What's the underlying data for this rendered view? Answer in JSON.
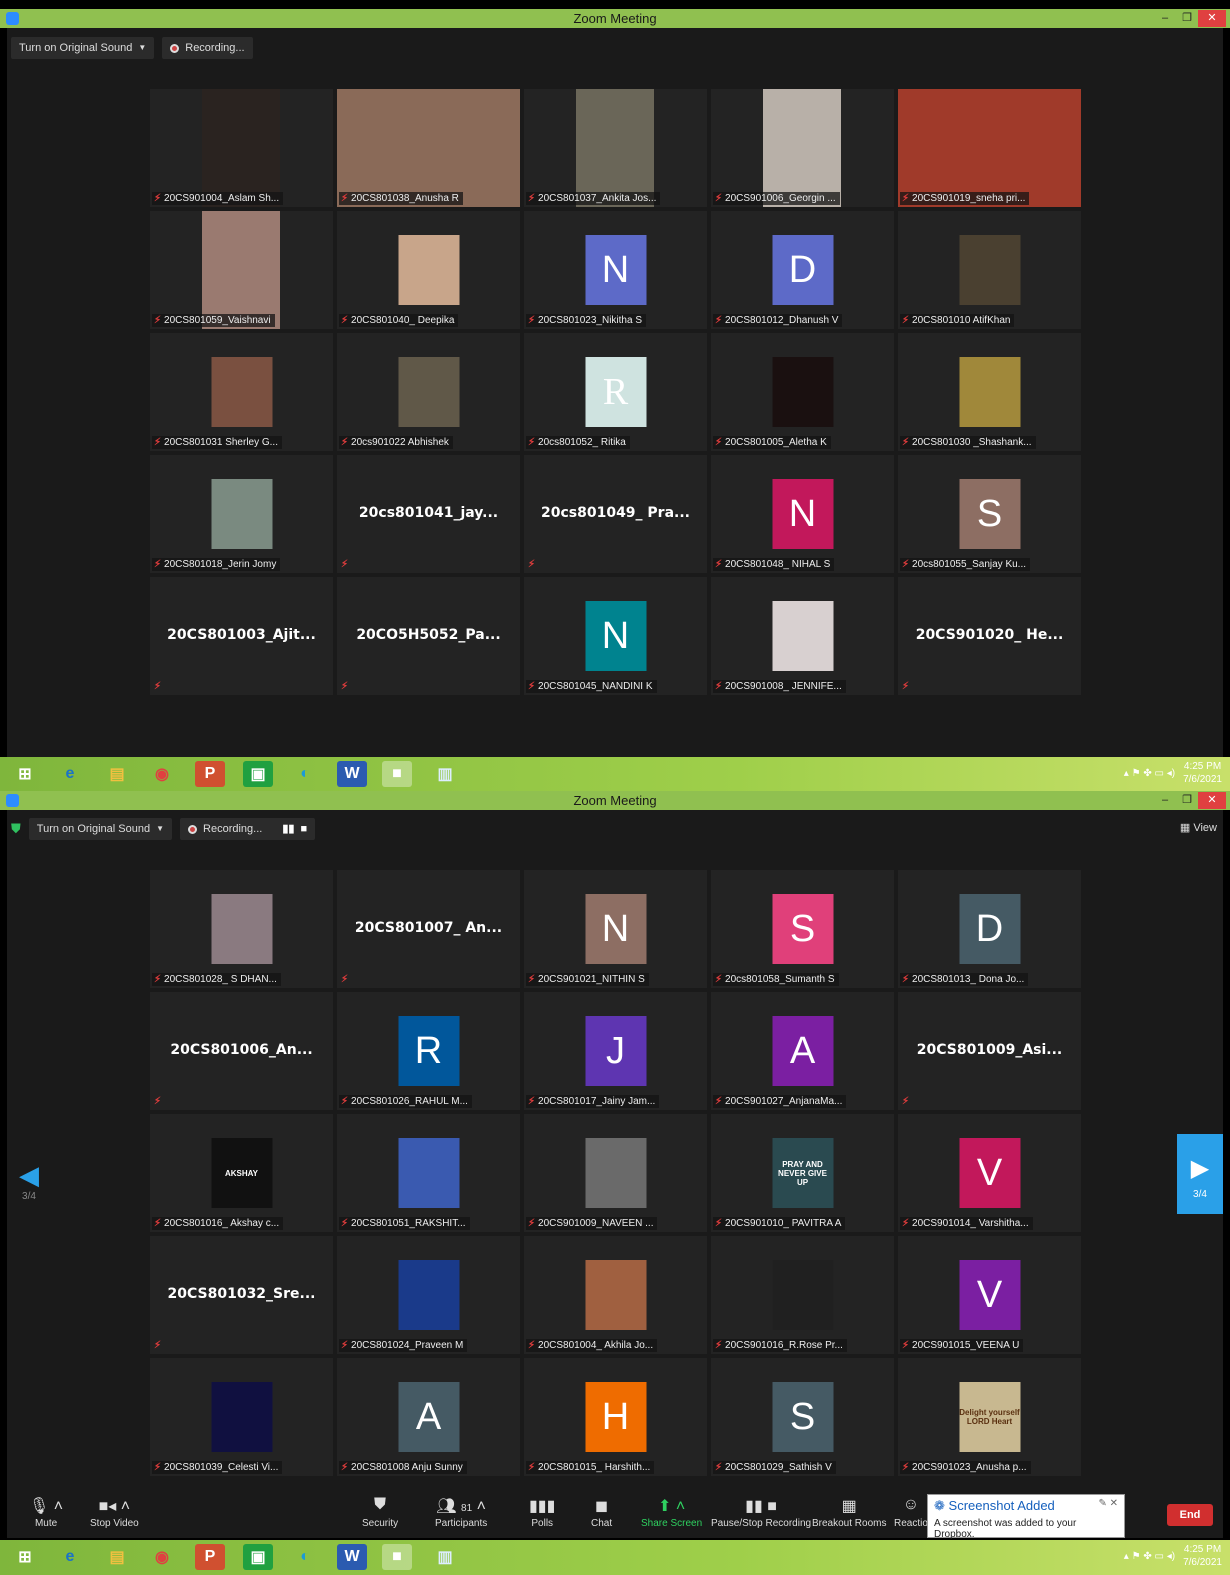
{
  "window1": {
    "title": "Zoom Meeting",
    "original_sound": "Turn on Original Sound",
    "recording": "Recording..."
  },
  "window2": {
    "title": "Zoom Meeting",
    "original_sound": "Turn on Original Sound",
    "recording": "Recording...",
    "view": "View",
    "page": "3/4"
  },
  "grid1": [
    {
      "name": "20CS901004_Aslam Sh...",
      "type": "video",
      "bg": "#2a2320"
    },
    {
      "name": "20CS801038_Anusha R",
      "type": "video",
      "bg": "#8a6a58"
    },
    {
      "name": "20CS801037_Ankita Jos...",
      "type": "video",
      "bg": "#6a6658"
    },
    {
      "name": "20CS901006_Georgin ...",
      "type": "video",
      "bg": "#b8b0a8"
    },
    {
      "name": "20CS901019_sneha pri...",
      "type": "video",
      "bg": "#a03a2a"
    },
    {
      "name": "20CS801059_Vaishnavi",
      "type": "video",
      "bg": "#9a7a70"
    },
    {
      "name": "20CS801040_ Deepika",
      "type": "photo",
      "bg": "#c8a58a"
    },
    {
      "name": "20CS801023_Nikitha S",
      "type": "letter",
      "letter": "N",
      "bg": "#5d6ac8"
    },
    {
      "name": "20CS801012_Dhanush V",
      "type": "letter",
      "letter": "D",
      "bg": "#5d6ac8"
    },
    {
      "name": "20CS801010 AtifKhan",
      "type": "photo",
      "bg": "#4a4030"
    },
    {
      "name": "20CS801031 Sherley G...",
      "type": "photo",
      "bg": "#7a5040"
    },
    {
      "name": "20cs901022 Abhishek",
      "type": "photo",
      "bg": "#605848"
    },
    {
      "name": "20cs801052_ Ritika",
      "type": "letter",
      "letter": "R",
      "bg": "#cfe3e0"
    },
    {
      "name": "20CS801005_Aletha K",
      "type": "photo",
      "bg": "#1a1010"
    },
    {
      "name": "20CS801030 _Shashank...",
      "type": "photo",
      "bg": "#a0883a"
    },
    {
      "name": "20CS801018_Jerin Jomy",
      "type": "photo",
      "bg": "#7a8a80"
    },
    {
      "name": "",
      "type": "text",
      "big": "20cs801041_jay..."
    },
    {
      "name": "",
      "type": "text",
      "big": "20cs801049_ Pra..."
    },
    {
      "name": "20CS801048_ NIHAL S",
      "type": "letter",
      "letter": "N",
      "bg": "#c2185b"
    },
    {
      "name": "20cs801055_Sanjay Ku...",
      "type": "letter",
      "letter": "S",
      "bg": "#8d6e63"
    },
    {
      "name": "",
      "type": "text",
      "big": "20CS801003_Ajit..."
    },
    {
      "name": "",
      "type": "text",
      "big": "20CO5H5052_Pa..."
    },
    {
      "name": "20CS801045_NANDINI K",
      "type": "letter",
      "letter": "N",
      "bg": "#00838f"
    },
    {
      "name": "20CS901008_ JENNIFE...",
      "type": "photo",
      "bg": "#d8d0d0"
    },
    {
      "name": "",
      "type": "text",
      "big": "20CS901020_ He..."
    }
  ],
  "grid2": [
    {
      "name": "20CS801028_ S DHAN...",
      "type": "photo",
      "bg": "#8a7a80"
    },
    {
      "name": "",
      "type": "text",
      "big": "20CS801007_ An..."
    },
    {
      "name": "20CS901021_NITHIN S",
      "type": "letter",
      "letter": "N",
      "bg": "#8d6e63"
    },
    {
      "name": "20cs801058_Sumanth S",
      "type": "letter",
      "letter": "S",
      "bg": "#e0407a"
    },
    {
      "name": "20CS801013_ Dona Jo...",
      "type": "letter",
      "letter": "D",
      "bg": "#455a64"
    },
    {
      "name": "",
      "type": "text",
      "big": "20CS801006_An..."
    },
    {
      "name": "20CS801026_RAHUL M...",
      "type": "letter",
      "letter": "R",
      "bg": "#01579b"
    },
    {
      "name": "20CS801017_Jainy Jam...",
      "type": "letter",
      "letter": "J",
      "bg": "#5e35b1"
    },
    {
      "name": "20CS901027_AnjanaMa...",
      "type": "letter",
      "letter": "A",
      "bg": "#7b1fa2"
    },
    {
      "name": "",
      "type": "text",
      "big": "20CS801009_Asi..."
    },
    {
      "name": "20CS801016_ Akshay c...",
      "type": "photo",
      "bg": "#111111",
      "caption": "AKSHAY"
    },
    {
      "name": "20CS801051_RAKSHIT...",
      "type": "photo",
      "bg": "#3a5ab0"
    },
    {
      "name": "20CS901009_NAVEEN ...",
      "type": "photo",
      "bg": "#6a6a6a"
    },
    {
      "name": "20CS901010_ PAVITRA A",
      "type": "photo",
      "bg": "#2a4a50",
      "caption": "PRAY AND NEVER GIVE UP"
    },
    {
      "name": "20CS901014_ Varshitha...",
      "type": "letter",
      "letter": "V",
      "bg": "#c2185b"
    },
    {
      "name": "",
      "type": "text",
      "big": "20CS801032_Sre..."
    },
    {
      "name": "20CS801024_Praveen M",
      "type": "photo",
      "bg": "#1a3a8a"
    },
    {
      "name": "20CS801004_ Akhila Jo...",
      "type": "photo",
      "bg": "#a06040"
    },
    {
      "name": "20CS901016_R.Rose Pr...",
      "type": "photo",
      "bg": "#202020"
    },
    {
      "name": "20CS901015_VEENA U",
      "type": "letter",
      "letter": "V",
      "bg": "#7b1fa2"
    },
    {
      "name": "20CS801039_Celesti Vi...",
      "type": "photo",
      "bg": "#101040"
    },
    {
      "name": "20CS801008 Anju Sunny",
      "type": "letter",
      "letter": "A",
      "bg": "#455a64"
    },
    {
      "name": "20CS801015_ Harshith...",
      "type": "letter",
      "letter": "H",
      "bg": "#ef6c00"
    },
    {
      "name": "20CS801029_Sathish V",
      "type": "letter",
      "letter": "S",
      "bg": "#455a64"
    },
    {
      "name": "20CS901023_Anusha p...",
      "type": "photo",
      "bg": "#c8b890",
      "caption": "Delight yourself LORD Heart"
    }
  ],
  "controls": {
    "mute": "Mute",
    "stop_video": "Stop Video",
    "security": "Security",
    "participants": "Participants",
    "participants_count": "81",
    "polls": "Polls",
    "chat": "Chat",
    "share": "Share Screen",
    "recording": "Pause/Stop Recording",
    "breakout": "Breakout Rooms",
    "reactions": "Reactio",
    "end": "End"
  },
  "toast": {
    "title": "Screenshot Added",
    "body": "A screenshot was added to your Dropbox."
  },
  "taskbar": {
    "time": "4:25 PM",
    "date": "7/6/2021"
  },
  "colors": {
    "title_bar": "#90c050",
    "meeting_bg": "#1a1a1a",
    "tile_bg": "#232323",
    "accent": "#2d8cff",
    "end": "#d12f2f"
  }
}
